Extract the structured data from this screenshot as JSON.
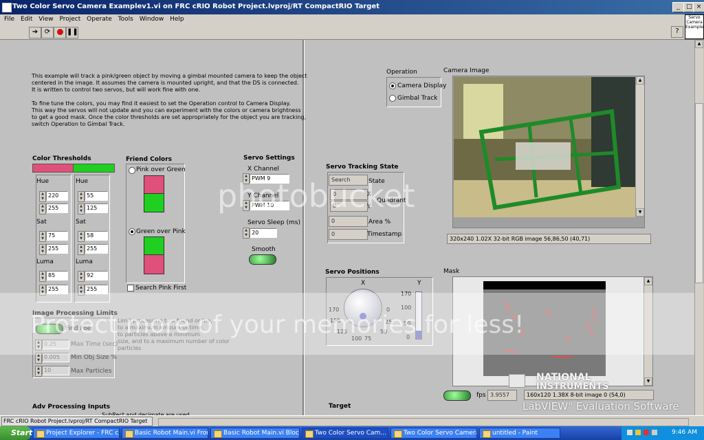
{
  "window": {
    "title": "Two Color Servo Camera Examplev1.vi on FRC cRIO Robot Project.lvproj/RT CompactRIO Target",
    "minimize": "_",
    "maximize": "□",
    "close": "×"
  },
  "menu": [
    "File",
    "Edit",
    "View",
    "Project",
    "Operate",
    "Tools",
    "Window",
    "Help"
  ],
  "vi_icon_text": "Servo Camera Example",
  "help_button": "?",
  "description": [
    "This example will track a pink/green object by moving a gimbal mounted camera to keep the object",
    "centered in the image. It assumes the camera is mounted upright, and that the DS is connected.",
    "It is written to control two servos, but will work fine with one.",
    "",
    "To fine tune the colors, you may find it easiest to set the Operation control to Camera Display.",
    "This way the servos will not update and you can experiment with the colors or camera brightness",
    " to get a good mask. Once the color thresholds are set appropriately for the object you are tracking,",
    "switch Operation to Gimbal Track."
  ],
  "color_thresholds": {
    "title": "Color Thresholds",
    "pink": {
      "hue_label": "Hue",
      "hue": [
        "220",
        "255"
      ],
      "sat_label": "Sat",
      "sat": [
        "75",
        "255"
      ],
      "luma_label": "Luma",
      "luma": [
        "85",
        "255"
      ]
    },
    "green": {
      "hue_label": "Hue",
      "hue": [
        "55",
        "125"
      ],
      "sat_label": "Sat",
      "sat": [
        "58",
        "255"
      ],
      "luma_label": "Luma",
      "luma": [
        "92",
        "255"
      ]
    },
    "pink_color": "#e0507a",
    "green_color": "#20d020"
  },
  "friend_colors": {
    "title": "Friend Colors",
    "option1": "Pink over Green",
    "option2": "Green over Pink",
    "search_pink_first": "Search Pink First"
  },
  "servo_settings": {
    "title": "Servo Settings",
    "x_label": "X Channel",
    "x_value": "PWM 9",
    "y_label": "Y Channel",
    "y_value": "PWM 10",
    "sleep_label": "Servo Sleep (ms)",
    "sleep_value": "20",
    "smooth_label": "Smooth"
  },
  "image_processing": {
    "title": "Image Processing Limits",
    "find_foe": "Find Foe",
    "note": [
      "Limit processing to a friend or foe,",
      "to a maximum amount of time,",
      "to particles above a minimum",
      "size, and to a maximum number of color",
      "particles"
    ],
    "max_time_label": "Max Time (sec)",
    "max_time": "0.25",
    "min_obj_label": "Min Obj Size %",
    "min_obj": "0.005",
    "max_particles_label": "Max Particles",
    "max_particles": "10"
  },
  "adv_processing": {
    "title": "Adv Processing Inputs",
    "note": "SubRect and decimate are used"
  },
  "operation": {
    "title": "Operation",
    "option1": "Camera Display",
    "option2": "Gimbal Track"
  },
  "camera_image": {
    "title": "Camera Image",
    "status": "320x240 1.02X 32-bit RGB image 56,86,50     (40,71)"
  },
  "tracking_state": {
    "title": "Servo Tracking State",
    "state_value": "Search",
    "state_label": "State",
    "x_value": "0",
    "x_label": "X",
    "y_value": "0",
    "y_label": "Y",
    "quadrant_label": "Quadrant",
    "area_value": "0",
    "area_label": "Area %",
    "timestamp_value": "0",
    "timestamp_label": "Timestamp"
  },
  "servo_positions": {
    "title": "Servo Positions",
    "x_label": "X",
    "y_label": "Y",
    "x_ticks": [
      "170",
      "150",
      "125",
      "100",
      "75",
      "50",
      "25",
      "0"
    ],
    "y_ticks": [
      "170",
      "100",
      "50",
      "0"
    ],
    "y_level_fraction": 0.18
  },
  "mask": {
    "title": "Mask",
    "fps_label": "fps",
    "fps_value": "3.9557",
    "status": "160x120 1.38X 8-bit image 0    (54,0)"
  },
  "target": {
    "title": "Target"
  },
  "ni_logo": {
    "line1": "NATIONAL",
    "line2": "INSTRUMENTS",
    "line3": "LabVIEW\" Evaluation Software"
  },
  "watermark": {
    "line1": "photobucket",
    "line2": "Protect more of your memories for less!"
  },
  "status_bar": "FRC cRIO Robot Project.lvproj/RT CompactRIO Target",
  "taskbar": {
    "start": "Start",
    "tasks": [
      "Project Explorer - FRC c...",
      "Basic Robot Main.vi Fron...",
      "Basic Robot Main.vi Block...",
      "Two Color Servo Cam...",
      "Two Color Servo Camera...",
      "untitled - Paint"
    ],
    "active_index": 3,
    "clock": "9:46 AM"
  }
}
